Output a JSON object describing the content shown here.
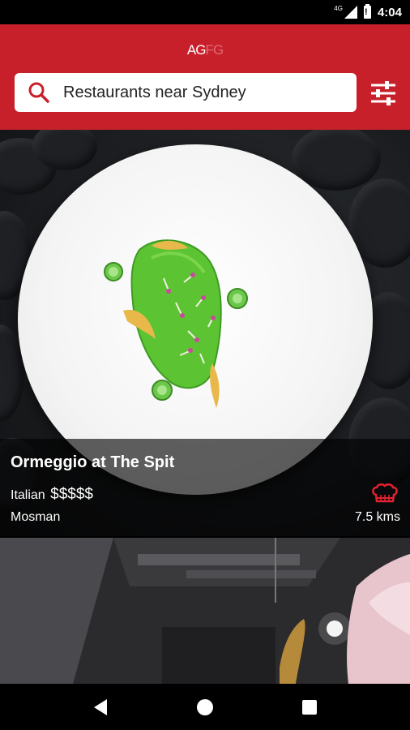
{
  "status_bar": {
    "network": "4G",
    "time": "4:04"
  },
  "header": {
    "logo_main": "AG",
    "logo_dim": "FG",
    "search": {
      "value": "Restaurants near Sydney"
    }
  },
  "restaurants": [
    {
      "name": "Ormeggio at The Spit",
      "cuisine": "Italian",
      "price": "$$$$$",
      "suburb": "Mosman",
      "distance": "7.5 kms",
      "hats": 1
    }
  ],
  "nav": {
    "back": "back-icon",
    "home": "home-icon",
    "recents": "recents-icon"
  },
  "colors": {
    "brand_red": "#c8202b",
    "hat_red": "#e0222f"
  }
}
